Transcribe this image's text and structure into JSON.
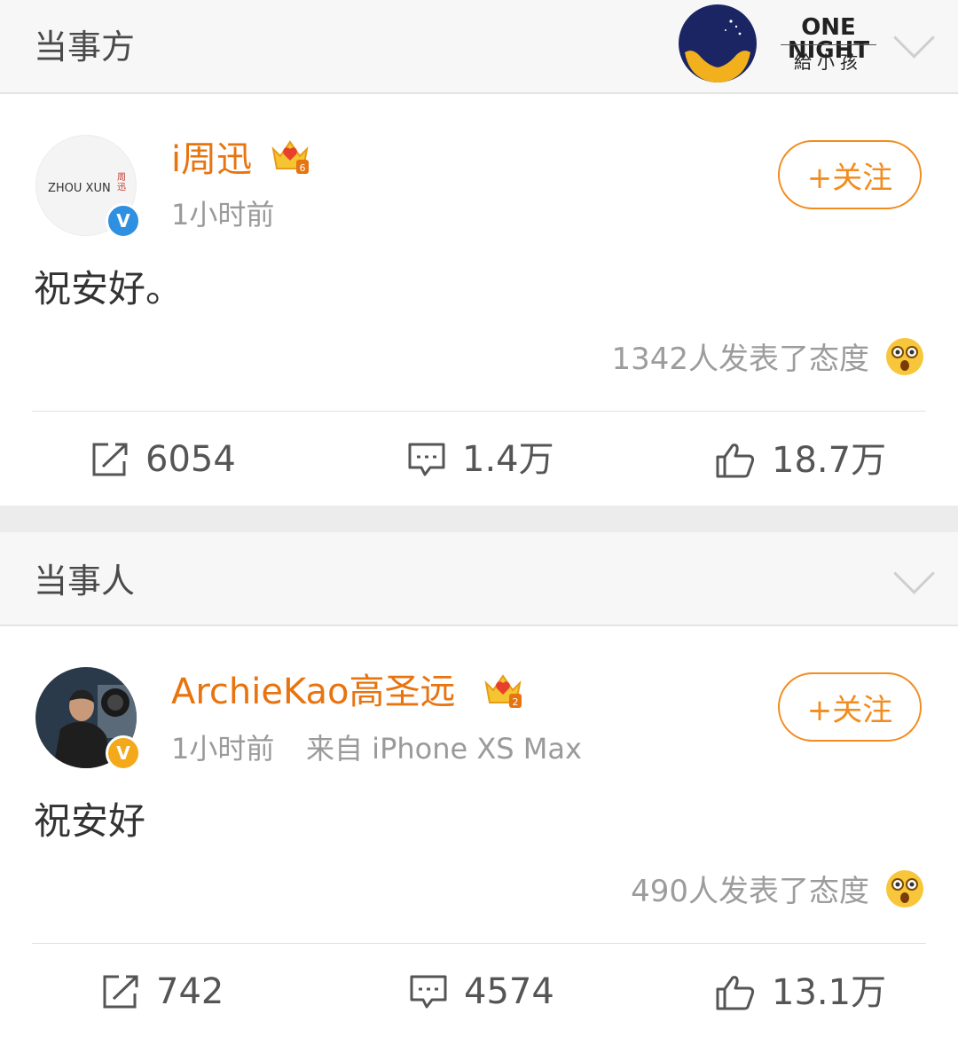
{
  "sections": [
    {
      "title": "当事方",
      "post": {
        "username": "i周迅",
        "avatar_text": "ZHOU XUN",
        "avatar_seal": "周迅",
        "time": "1小时前",
        "source": "",
        "follow_label": "+关注",
        "content": "祝安好。",
        "attitude": "1342人发表了态度",
        "repost_count": "6054",
        "comment_count": "1.4万",
        "like_count": "18.7万"
      }
    },
    {
      "title": "当事人",
      "post": {
        "username": "ArchieKao高圣远",
        "time": "1小时前",
        "source": "来自 iPhone XS Max",
        "follow_label": "+关注",
        "content": "祝安好",
        "attitude": "490人发表了态度",
        "repost_count": "742",
        "comment_count": "4574",
        "like_count": "13.1万"
      }
    }
  ],
  "badge": {
    "title": "ONE NIGHT",
    "subtitle": "給小孩"
  },
  "colors": {
    "accent": "#f28c1e",
    "username": "#e8740f",
    "verify_blue": "#2f8fe0",
    "verify_gold": "#f3a91a"
  }
}
